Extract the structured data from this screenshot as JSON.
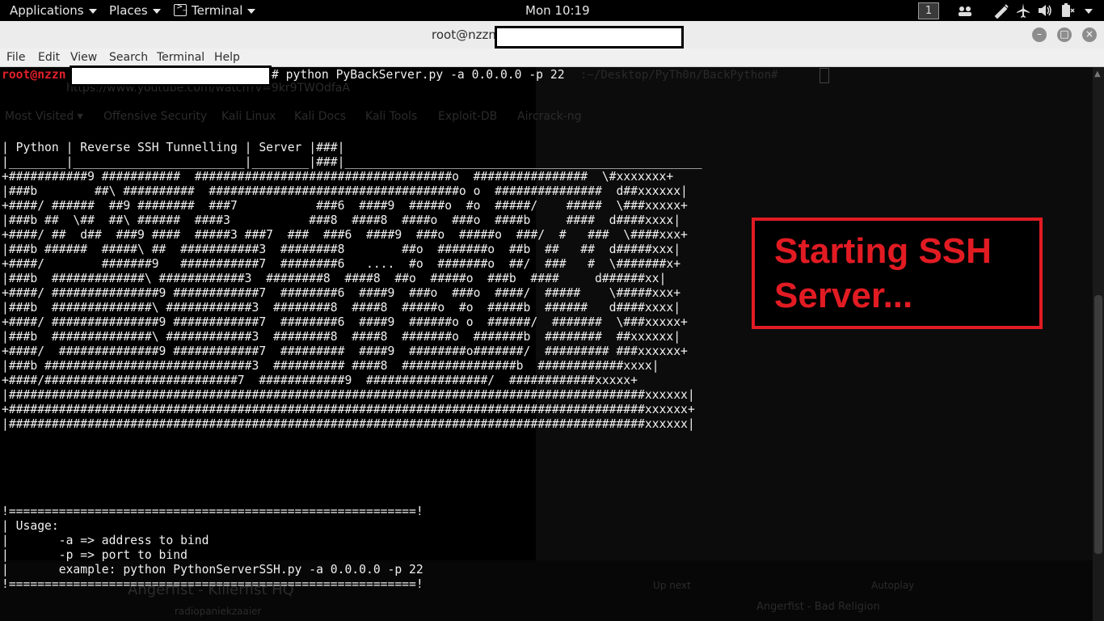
{
  "topbar": {
    "applications": "Applications",
    "places": "Places",
    "terminal_app": "Terminal",
    "clock": "Mon 10:19",
    "workspace": "1"
  },
  "window": {
    "title": "root@nzzn:",
    "controls": {
      "minimize": "–",
      "maximize": "□",
      "close": "×"
    }
  },
  "menubar": [
    "File",
    "Edit",
    "View",
    "Search",
    "Terminal",
    "Help"
  ],
  "terminal": {
    "prompt_user": "root@nzzn",
    "command": "# python PyBackServer.py -a 0.0.0.0 -p 22",
    "ghost_prompt": ":~/Desktop/PyTh0n/BackPython# ",
    "banner": [
      "| Python | Reverse SSH Tunnelling | Server |###|",
      "|________|________________________|________|###|__________________________________________________",
      "+###########9 ###########  ####################################o  ################  \\#xxxxxxx+",
      "|###b        ##\\ ##########  ###################################o o  ###############  d##xxxxxx|",
      "+####/ ######  ##9 ########  ###7           ###6  ####9  #####o  #o  #####/    #####  \\###xxxxx+",
      "|###b ##  \\##  ##\\ ######  ####3           ###8  ####8  ####o  ###o  ####b     ####  d####xxxx|",
      "+####/ ##  d##  ###9 ####  #####3 ###7  ###  ###6  ####9  ###o  #####o  ###/  #   ###  \\####xxx+",
      "|###b ######  #####\\ ##  ###########3  ########8        ##o  #######o  ##b  ##   ##  d#####xxx|",
      "+####/        #######9   ###########7  ########6   ....  #o  #######o  ##/  ###   #  \\#######x+",
      "|###b  #############\\ ############3  ########8  ####8  ##o  #####o  ###b  ####     d######xx|",
      "+####/ ###############9 ############7  ########6  ####9  ###o  ###o  ####/  #####    \\#####xxx+",
      "|###b  ##############\\ ############3  ########8  ####8  #####o  #o  #####b  ######   d####xxxx|",
      "+####/ ###############9 ############7  ########6  ####9  ######o o  ######/  #######  \\###xxxxx+",
      "|###b  ##############\\ ############3  ########8  ####8  #######o  #######b  ########  ##xxxxxx|",
      "+####/  ##############9 ############7  #########  ####9  ########o#######/  ######### ###xxxxxx+",
      "|###b #############################3  ########## ####8  ################b  ############xxxx|",
      "+####/###########################7  ############9  #################/  ############xxxxx+",
      "|#########################################################################################xxxxxx|",
      "+#########################################################################################xxxxxx+",
      "|#########################################################################################xxxxxx|"
    ],
    "usage": [
      "!=========================================================!",
      "| Usage:",
      "|       -a => address to bind",
      "|       -p => port to bind",
      "|       example: python PythonServerSSH.py -a 0.0.0.0 -p 22",
      "!=========================================================!"
    ],
    "ghost_browser": {
      "url": "https://www.youtube.com/watch?v=9kr9TWOdfaA",
      "bookmarks": [
        "Most Visited ▾",
        "Offensive Security",
        "Kali Linux",
        "Kali Docs",
        "Kali Tools",
        "Exploit-DB",
        "Aircrack-ng"
      ],
      "video_title": "Angerfist - Killerfist HQ",
      "channel": "radiopaniekzaaier",
      "upnext_label": "Up next",
      "autoplay_label": "Autoplay",
      "upnext_title": "Angerfist - Bad Religion"
    }
  },
  "callout": {
    "text_line1": "Starting SSH",
    "text_line2": "Server..."
  }
}
